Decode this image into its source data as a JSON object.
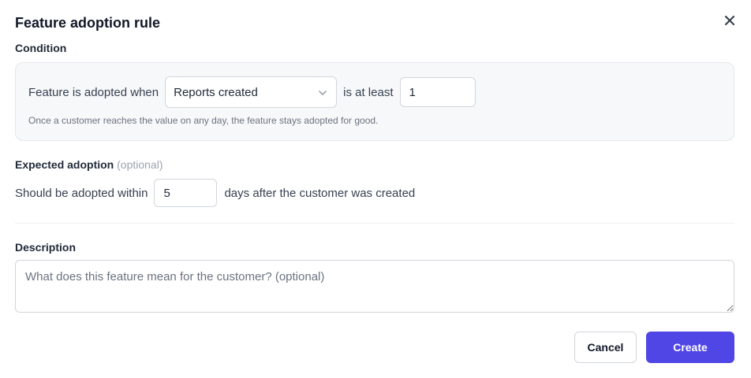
{
  "dialog": {
    "title": "Feature adoption rule",
    "close_icon": "close-icon"
  },
  "condition": {
    "label": "Condition",
    "prefix": "Feature is adopted when",
    "metric_select": {
      "value": "Reports created",
      "icon": "chevron-down-icon"
    },
    "comparator": "is at least",
    "threshold": "1",
    "hint": "Once a customer reaches the value on any day, the feature stays adopted for good."
  },
  "expected": {
    "label": "Expected adoption",
    "optional": "(optional)",
    "prefix": "Should be adopted within",
    "days": "5",
    "suffix": "days after the customer was created"
  },
  "description": {
    "label": "Description",
    "placeholder": "What does this feature mean for the customer? (optional)",
    "value": ""
  },
  "actions": {
    "cancel_label": "Cancel",
    "create_label": "Create"
  },
  "colors": {
    "primary": "#4f46e5",
    "panel_bg": "#f7f8fa",
    "border": "#d1d5db"
  }
}
